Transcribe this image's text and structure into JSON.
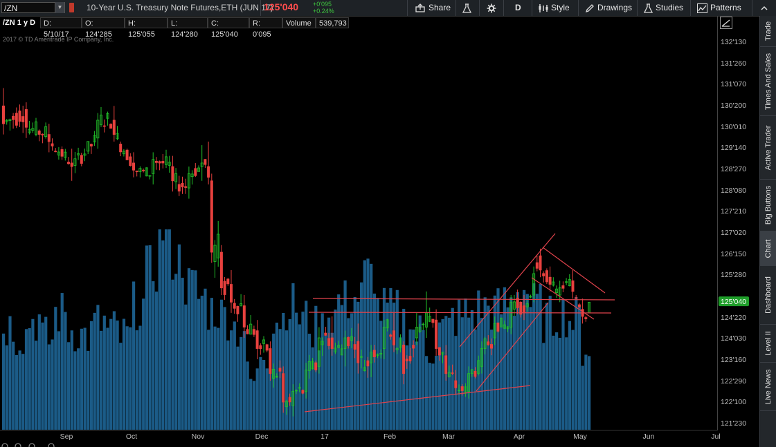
{
  "toolbar": {
    "symbol": "/ZN",
    "description": "10-Year U.S. Treasury Note Futures,ETH (JUN 17)",
    "last": "125'040",
    "change_abs": "+0'095",
    "change_pct": "+0.24%",
    "share": "Share",
    "period": "D",
    "style": "Style",
    "drawings": "Drawings",
    "studies": "Studies",
    "patterns": "Patterns"
  },
  "infobar": {
    "title": "/ZN 1 y D",
    "date": "D: 5/10/17",
    "open": "O: 124'285",
    "high": "H: 125'055",
    "low": "L: 124'280",
    "close": "C: 125'040",
    "range": "R: 0'095",
    "volume_label": "Volume",
    "volume_value": "539,793"
  },
  "copyright": "2017 © TD Ameritrade IP Company, Inc.",
  "side_tabs": [
    "Trade",
    "Times And Sales",
    "Active Trader",
    "Big Buttons",
    "Chart",
    "Dashboard",
    "Level II",
    "Live News"
  ],
  "colors": {
    "up": "#22c22a",
    "down": "#e8413e",
    "volume": "#1b5b87",
    "trendline": "#e0434c",
    "price_badge": "#1f9e2a"
  },
  "chart_data": {
    "type": "candlestick",
    "title": "",
    "price_axis_ticks": [
      "132'130",
      "131'260",
      "131'070",
      "130'200",
      "130'010",
      "129'140",
      "128'270",
      "128'080",
      "127'210",
      "127'020",
      "126'150",
      "125'280",
      "124'220",
      "124'030",
      "123'160",
      "122'290",
      "122'100",
      "121'230"
    ],
    "time_axis_ticks": [
      "Sep",
      "Oct",
      "Nov",
      "Dec",
      "17",
      "Feb",
      "Mar",
      "Apr",
      "May",
      "Jun",
      "Jul"
    ],
    "last_price_label": "125'040",
    "ylim_points": [
      121.719,
      132.406
    ],
    "anchor_trading_days": [
      {
        "d": 0,
        "o": 130.6,
        "h": 131.1,
        "l": 129.8,
        "c": 130.1
      },
      {
        "d": 7,
        "o": 130.5,
        "h": 130.7,
        "l": 129.7,
        "c": 130.0
      },
      {
        "d": 14,
        "o": 129.8,
        "h": 130.1,
        "l": 129.3,
        "c": 129.6
      },
      {
        "d": 21,
        "o": 129.0,
        "h": 129.4,
        "l": 128.5,
        "c": 128.9
      },
      {
        "d": 29,
        "o": 129.7,
        "h": 130.4,
        "l": 129.4,
        "c": 130.2
      },
      {
        "d": 34,
        "o": 130.2,
        "h": 130.6,
        "l": 129.6,
        "c": 129.8
      },
      {
        "d": 40,
        "o": 129.0,
        "h": 129.3,
        "l": 128.6,
        "c": 128.8
      },
      {
        "d": 46,
        "o": 128.7,
        "h": 129.3,
        "l": 128.4,
        "c": 129.1
      },
      {
        "d": 52,
        "o": 128.9,
        "h": 129.2,
        "l": 128.2,
        "c": 128.5
      },
      {
        "d": 57,
        "o": 128.3,
        "h": 128.9,
        "l": 128.0,
        "c": 128.7
      },
      {
        "d": 61,
        "o": 128.9,
        "h": 129.5,
        "l": 128.5,
        "c": 129.0
      },
      {
        "d": 63,
        "o": 128.9,
        "h": 129.6,
        "l": 128.4,
        "c": 128.6
      },
      {
        "d": 64,
        "o": 128.5,
        "h": 128.7,
        "l": 126.2,
        "c": 126.5
      },
      {
        "d": 67,
        "o": 126.5,
        "h": 126.7,
        "l": 125.3,
        "c": 125.5
      },
      {
        "d": 70,
        "o": 125.6,
        "h": 126.0,
        "l": 124.8,
        "c": 125.1
      },
      {
        "d": 74,
        "o": 125.0,
        "h": 125.3,
        "l": 124.1,
        "c": 124.4
      },
      {
        "d": 78,
        "o": 124.3,
        "h": 124.6,
        "l": 123.5,
        "c": 123.8
      },
      {
        "d": 82,
        "o": 123.8,
        "h": 124.0,
        "l": 122.9,
        "c": 123.1
      },
      {
        "d": 86,
        "o": 123.1,
        "h": 123.3,
        "l": 122.0,
        "c": 122.3
      },
      {
        "d": 89,
        "o": 122.2,
        "h": 122.8,
        "l": 121.9,
        "c": 122.6
      },
      {
        "d": 93,
        "o": 122.6,
        "h": 123.4,
        "l": 122.4,
        "c": 123.2
      },
      {
        "d": 97,
        "o": 123.3,
        "h": 124.4,
        "l": 123.1,
        "c": 124.1
      },
      {
        "d": 101,
        "o": 124.1,
        "h": 124.7,
        "l": 123.6,
        "c": 123.8
      },
      {
        "d": 105,
        "o": 123.8,
        "h": 124.3,
        "l": 123.3,
        "c": 124.1
      },
      {
        "d": 109,
        "o": 124.0,
        "h": 124.5,
        "l": 123.1,
        "c": 123.4
      },
      {
        "d": 113,
        "o": 123.4,
        "h": 123.9,
        "l": 123.0,
        "c": 123.7
      },
      {
        "d": 117,
        "o": 123.8,
        "h": 124.6,
        "l": 123.5,
        "c": 124.4
      },
      {
        "d": 120,
        "o": 124.3,
        "h": 124.8,
        "l": 123.7,
        "c": 123.9
      },
      {
        "d": 123,
        "o": 123.9,
        "h": 124.0,
        "l": 122.8,
        "c": 123.1
      },
      {
        "d": 127,
        "o": 124.1,
        "h": 124.8,
        "l": 123.9,
        "c": 124.4
      },
      {
        "d": 130,
        "o": 124.4,
        "h": 125.4,
        "l": 124.1,
        "c": 124.8
      },
      {
        "d": 133,
        "o": 124.6,
        "h": 124.9,
        "l": 123.6,
        "c": 123.8
      },
      {
        "d": 136,
        "o": 123.6,
        "h": 123.9,
        "l": 122.9,
        "c": 123.1
      },
      {
        "d": 139,
        "o": 122.9,
        "h": 123.2,
        "l": 122.5,
        "c": 122.7
      },
      {
        "d": 143,
        "o": 122.6,
        "h": 123.3,
        "l": 122.4,
        "c": 123.1
      },
      {
        "d": 147,
        "o": 123.3,
        "h": 124.0,
        "l": 123.1,
        "c": 123.8
      },
      {
        "d": 151,
        "o": 124.1,
        "h": 124.7,
        "l": 123.9,
        "c": 124.5
      },
      {
        "d": 156,
        "o": 124.4,
        "h": 125.3,
        "l": 124.2,
        "c": 125.1
      },
      {
        "d": 160,
        "o": 125.0,
        "h": 125.3,
        "l": 124.6,
        "c": 124.8
      },
      {
        "d": 163,
        "o": 125.3,
        "h": 126.1,
        "l": 125.1,
        "c": 125.9
      },
      {
        "d": 165,
        "o": 126.4,
        "h": 126.6,
        "l": 125.8,
        "c": 126.0
      },
      {
        "d": 168,
        "o": 125.8,
        "h": 126.1,
        "l": 125.4,
        "c": 125.6
      },
      {
        "d": 171,
        "o": 125.3,
        "h": 125.7,
        "l": 125.1,
        "c": 125.5
      },
      {
        "d": 175,
        "o": 125.7,
        "h": 126.0,
        "l": 125.2,
        "c": 125.4
      },
      {
        "d": 178,
        "o": 124.9,
        "h": 125.2,
        "l": 124.5,
        "c": 124.7
      },
      {
        "d": 180,
        "o": 124.8,
        "h": 125.1,
        "l": 124.8,
        "c": 125.1
      }
    ],
    "volume_ratio": [
      0.52,
      0.48,
      0.55,
      0.45,
      0.58,
      0.5,
      0.47,
      0.53,
      0.49,
      0.46,
      0.62,
      0.8,
      1.0,
      0.85,
      0.72,
      0.66,
      0.6,
      0.57,
      0.51,
      0.24,
      0.4,
      0.56,
      0.62,
      0.55,
      0.5,
      0.58,
      0.64,
      0.66,
      0.78,
      0.6,
      0.59,
      0.54,
      0.48,
      0.42,
      0.5,
      0.56,
      0.58,
      0.61,
      0.6,
      0.63,
      0.7,
      0.62,
      0.55,
      0.58,
      0.55,
      0.42
    ]
  }
}
